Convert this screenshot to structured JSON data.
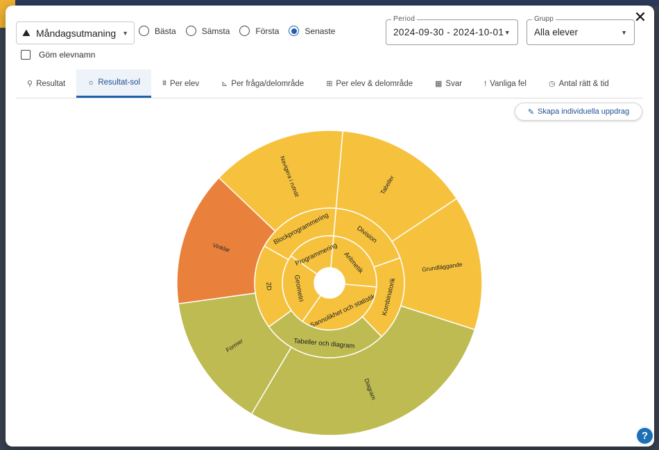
{
  "challenge": {
    "icon": "mountain-icon",
    "label": "Måndagsutmaning"
  },
  "filters": [
    {
      "label": "Bästa",
      "selected": false
    },
    {
      "label": "Sämsta",
      "selected": false
    },
    {
      "label": "Första",
      "selected": false
    },
    {
      "label": "Senaste",
      "selected": true
    }
  ],
  "hide_names": {
    "label": "Göm elevnamn",
    "checked": false
  },
  "period": {
    "legend": "Period",
    "value": "2024-09-30 - 2024-10-01"
  },
  "grupp": {
    "legend": "Grupp",
    "value": "Alla elever"
  },
  "tabs": [
    {
      "label": "Resultat",
      "icon": "binoculars-icon",
      "glyph": "⚲",
      "active": false
    },
    {
      "label": "Resultat-sol",
      "icon": "sun-icon",
      "glyph": "☼",
      "active": true
    },
    {
      "label": "Per elev",
      "icon": "students-icon",
      "glyph": "⩩",
      "active": false
    },
    {
      "label": "Per fråga/delområde",
      "icon": "bar-chart-icon",
      "glyph": "⊾",
      "active": false
    },
    {
      "label": "Per elev & delområde",
      "icon": "table-icon",
      "glyph": "⊞",
      "active": false
    },
    {
      "label": "Svar",
      "icon": "grid-icon",
      "glyph": "▦",
      "active": false
    },
    {
      "label": "Vanliga fel",
      "icon": "exclamation-icon",
      "glyph": "!",
      "active": false
    },
    {
      "label": "Antal rätt & tid",
      "icon": "clock-icon",
      "glyph": "◷",
      "active": false
    }
  ],
  "create_button": {
    "label": "Skapa individuella uppdrag",
    "icon": "edit-note-icon"
  },
  "colors": {
    "yellow": "#f6c23e",
    "orange": "#e9813c",
    "olive": "#bdbb51",
    "accent": "#1f5fae"
  },
  "chart_data": {
    "type": "sunburst",
    "title": "",
    "rings": [
      {
        "level": 1,
        "segments": [
          {
            "name": "Aritmetik",
            "value": 3,
            "color": "#f6c23e"
          },
          {
            "name": "Sannolikhet och statistik",
            "value": 4,
            "color": "#f6c23e"
          },
          {
            "name": "Geometri",
            "value": 3,
            "color": "#f6c23e"
          },
          {
            "name": "Programmering",
            "value": 2,
            "color": "#f6c23e"
          }
        ]
      },
      {
        "level": 2,
        "segments": [
          {
            "name": "Division",
            "value": 2,
            "color": "#f6c23e"
          },
          {
            "name": "Kombinatorik",
            "value": 2,
            "color": "#f6c23e"
          },
          {
            "name": "Tabeller och diagram",
            "value": 3,
            "color": "#bdbb51"
          },
          {
            "name": "2D",
            "value": 2,
            "color": "#f6c23e"
          },
          {
            "name": "Blockprogrammering",
            "value": 2,
            "color": "#f6c23e"
          }
        ]
      },
      {
        "level": 3,
        "segments": [
          {
            "name": "Tabeller",
            "value": 2,
            "color": "#f6c23e"
          },
          {
            "name": "Grundläggande",
            "value": 2,
            "color": "#f6c23e"
          },
          {
            "name": "Diagram",
            "value": 4,
            "color": "#bdbb51"
          },
          {
            "name": "Former",
            "value": 2,
            "color": "#bdbb51"
          },
          {
            "name": "Vinklar",
            "value": 2,
            "color": "#e9813c"
          },
          {
            "name": "Navigera i rutnät",
            "value": 2,
            "color": "#f6c23e"
          }
        ]
      }
    ]
  }
}
